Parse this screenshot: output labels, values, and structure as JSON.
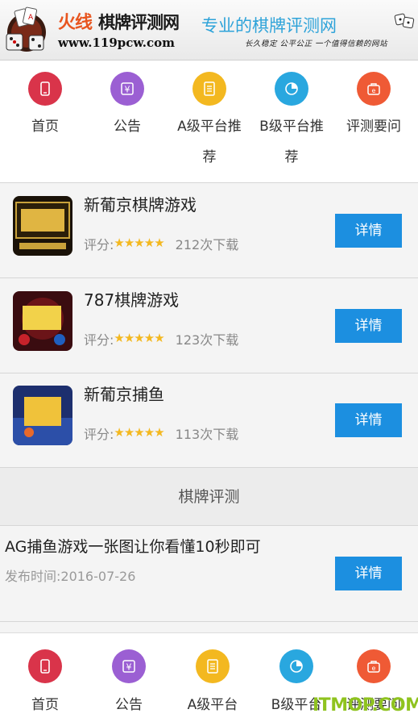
{
  "header": {
    "brand_fire": "火线",
    "brand_rest": "棋牌评测网",
    "brand_url": "www.119pcw.com",
    "slogan": "专业的棋牌评测网",
    "slogan_sub": "长久稳定 公平公正 一个值得信赖的网站"
  },
  "nav": [
    {
      "label": "首页",
      "icon": "phone-icon",
      "color": "#d9344a"
    },
    {
      "label": "公告",
      "icon": "yen-icon",
      "color": "#9b5fd3"
    },
    {
      "label": "A级平台推荐",
      "icon": "document-icon",
      "color": "#f3b820"
    },
    {
      "label": "B级平台推荐",
      "icon": "pie-chart-icon",
      "color": "#29a7df"
    },
    {
      "label": "评测要问",
      "icon": "e-bag-icon",
      "color": "#ef5a35"
    }
  ],
  "games": [
    {
      "name": "新葡京棋牌游戏",
      "rating_label": "评分:",
      "stars": "★★★★★",
      "downloads": "212次下载",
      "button": "详情"
    },
    {
      "name": "787棋牌游戏",
      "rating_label": "评分:",
      "stars": "★★★★★",
      "downloads": "123次下载",
      "button": "详情"
    },
    {
      "name": "新葡京捕鱼",
      "rating_label": "评分:",
      "stars": "★★★★★",
      "downloads": "113次下载",
      "button": "详情"
    }
  ],
  "section_title": "棋牌评测",
  "article": {
    "title": "AG捕鱼游戏一张图让你看懂10秒即可",
    "date": "发布时间:2016-07-26",
    "button": "详情"
  },
  "tabbar": [
    {
      "label": "首页",
      "icon": "phone-icon",
      "color": "#d9344a"
    },
    {
      "label": "公告",
      "icon": "yen-icon",
      "color": "#9b5fd3"
    },
    {
      "label": "A级平台",
      "icon": "document-icon",
      "color": "#f3b820"
    },
    {
      "label": "B级平台",
      "icon": "pie-chart-icon",
      "color": "#29a7df"
    },
    {
      "label": "评测要问",
      "icon": "e-bag-icon",
      "color": "#ef5a35"
    }
  ],
  "watermark": "ITMOP.COM",
  "colors": {
    "accent_button": "#1c8fe0",
    "star": "#f3b820",
    "slogan": "#2ea3d9"
  }
}
